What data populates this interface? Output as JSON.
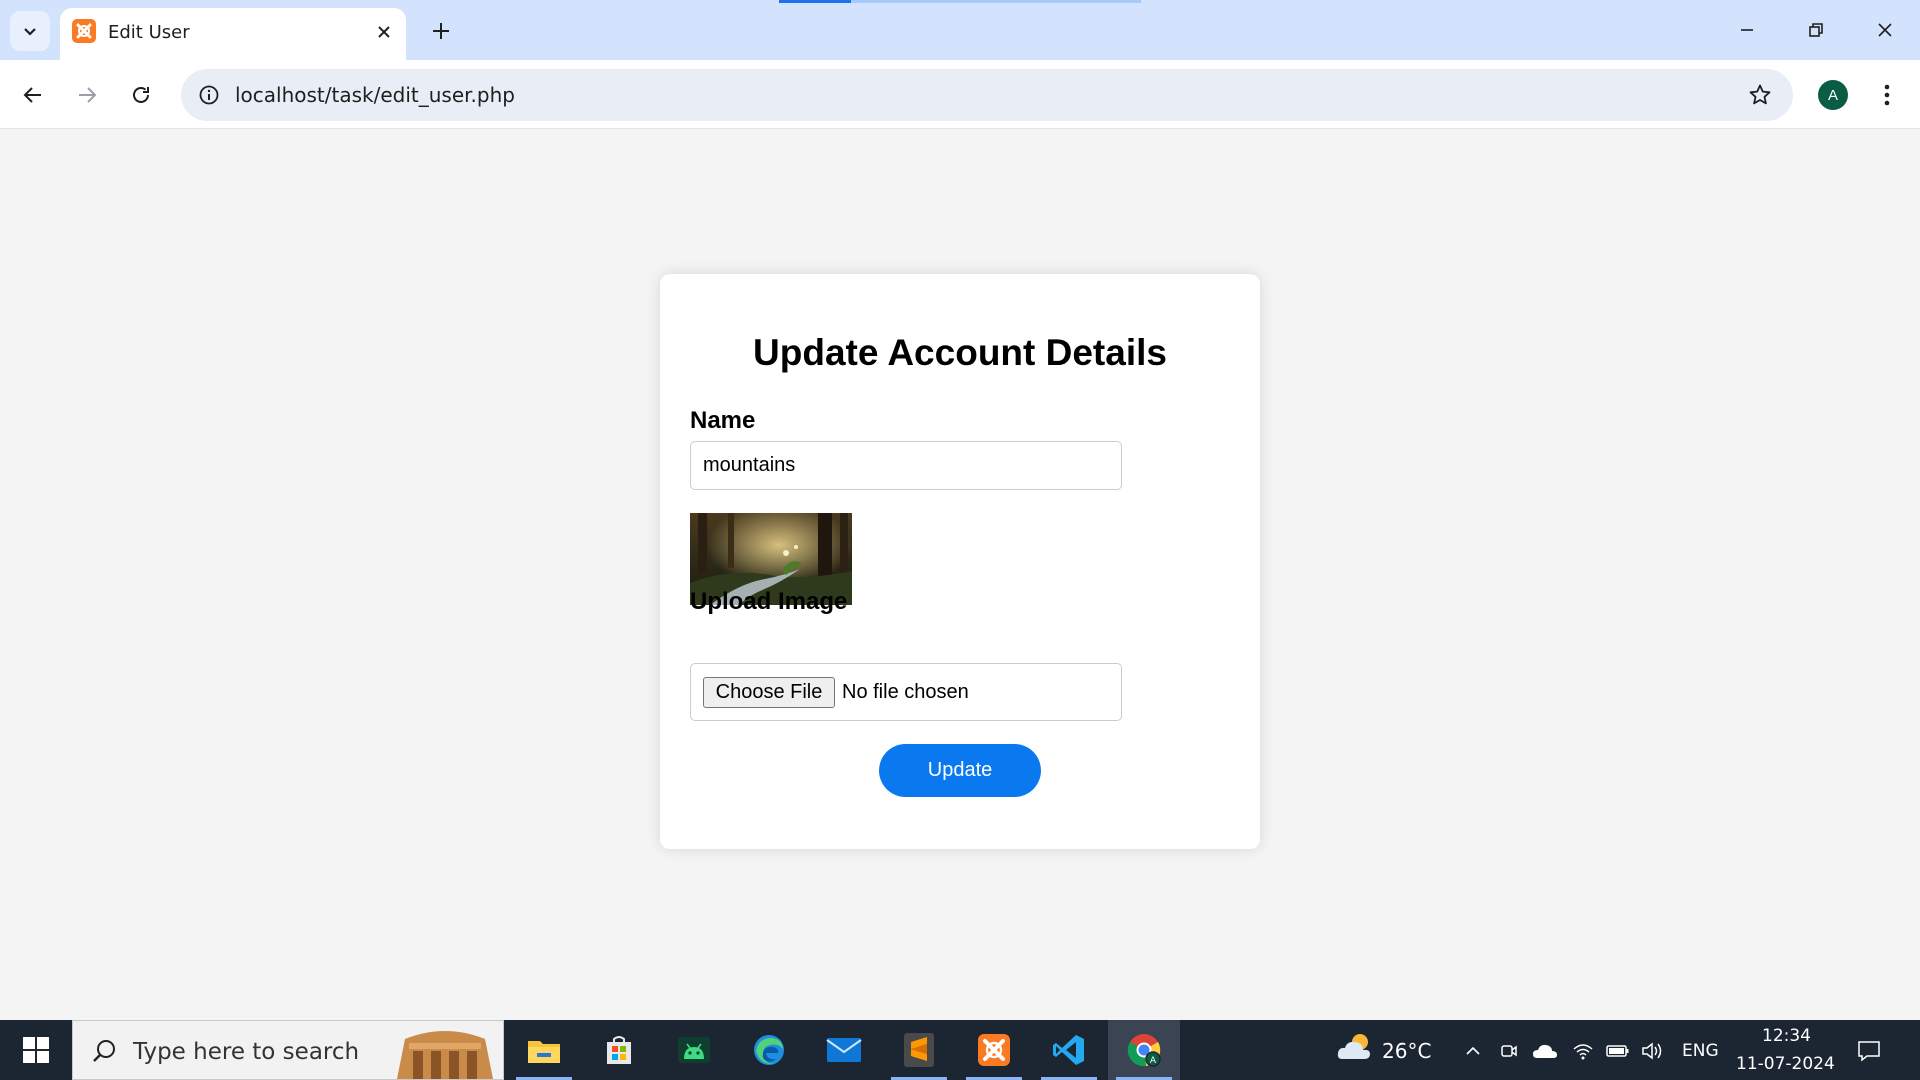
{
  "browser": {
    "tab_title": "Edit User",
    "url": "localhost/task/edit_user.php",
    "profile_initial": "A"
  },
  "page": {
    "heading": "Update Account Details",
    "name_label": "Name",
    "name_value": "mountains",
    "upload_label": "Upload Image",
    "choose_file_label": "Choose File",
    "no_file_text": "No file chosen",
    "update_button": "Update"
  },
  "taskbar": {
    "search_placeholder": "Type here to search",
    "weather_temp": "26°C",
    "language": "ENG",
    "time": "12:34",
    "date": "11-07-2024",
    "apps": [
      "file-explorer",
      "microsoft-store",
      "android-studio",
      "edge",
      "mail",
      "sublime-text",
      "xampp",
      "vscode",
      "chrome"
    ]
  },
  "colors": {
    "tabstrip": "#d3e3fd",
    "accent_button": "#0a79f0",
    "page_bg": "#f4f4f4",
    "taskbar": "#1c2633"
  }
}
